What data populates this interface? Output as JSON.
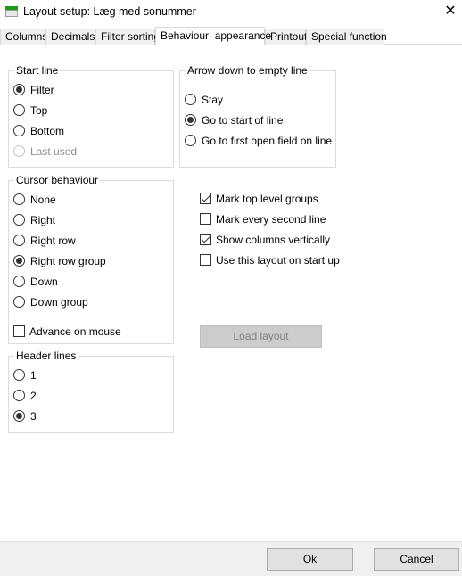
{
  "window": {
    "title": "Layout setup: Læg med sonummer",
    "close_glyph": "✕"
  },
  "tabs": [
    {
      "label": "Columns",
      "active": false
    },
    {
      "label": "Decimals",
      "active": false
    },
    {
      "label": "Filter sorting",
      "active": false
    },
    {
      "label": "Behaviour  appearance",
      "active": true
    },
    {
      "label": "Printout",
      "active": false
    },
    {
      "label": "Special function",
      "active": false
    }
  ],
  "start_line": {
    "legend": "Start line",
    "options": [
      {
        "label": "Filter",
        "selected": true,
        "enabled": true
      },
      {
        "label": "Top",
        "selected": false,
        "enabled": true
      },
      {
        "label": "Bottom",
        "selected": false,
        "enabled": true
      },
      {
        "label": "Last used",
        "selected": false,
        "enabled": false
      }
    ]
  },
  "arrow_down": {
    "legend": "Arrow down to empty line",
    "options": [
      {
        "label": "Stay",
        "selected": false
      },
      {
        "label": "Go to start of line",
        "selected": true
      },
      {
        "label": "Go to first open field on line",
        "selected": false
      }
    ]
  },
  "cursor_behaviour": {
    "legend": "Cursor behaviour",
    "options": [
      {
        "label": "None",
        "selected": false
      },
      {
        "label": "Right",
        "selected": false
      },
      {
        "label": "Right row",
        "selected": false
      },
      {
        "label": "Right row group",
        "selected": true
      },
      {
        "label": "Down",
        "selected": false
      },
      {
        "label": "Down group",
        "selected": false
      }
    ],
    "advance_on_mouse": {
      "label": "Advance on mouse",
      "checked": false
    }
  },
  "header_lines": {
    "legend": "Header lines",
    "options": [
      {
        "label": "1",
        "selected": false
      },
      {
        "label": "2",
        "selected": false
      },
      {
        "label": "3",
        "selected": true
      }
    ]
  },
  "checkboxes": [
    {
      "label": "Mark top level groups",
      "checked": true
    },
    {
      "label": "Mark every second line",
      "checked": false
    },
    {
      "label": "Show columns vertically",
      "checked": true
    },
    {
      "label": "Use this layout on start up",
      "checked": false
    }
  ],
  "load_layout_label": "Load layout",
  "footer": {
    "ok_label": "Ok",
    "cancel_label": "Cancel"
  }
}
